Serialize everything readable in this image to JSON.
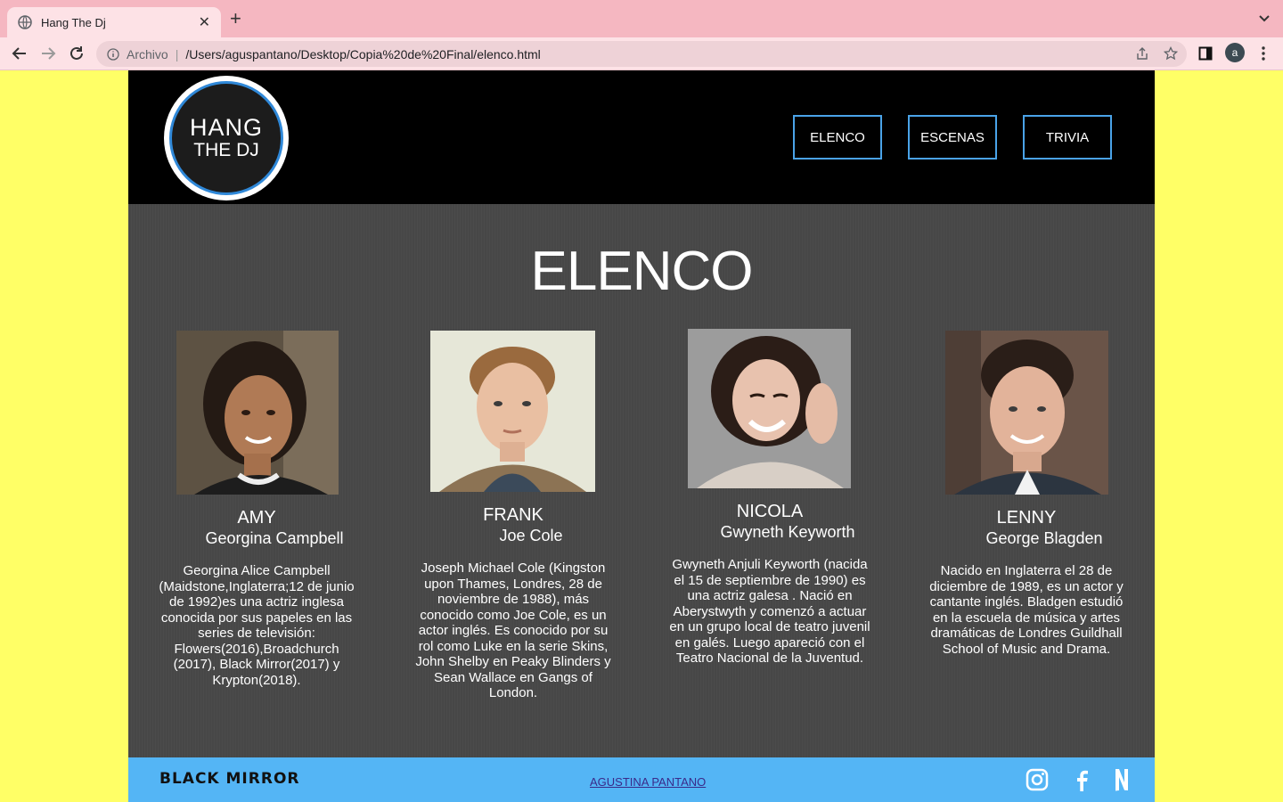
{
  "browser": {
    "tab_title": "Hang The Dj",
    "address_scheme": "Archivo",
    "address_path": "/Users/aguspantano/Desktop/Copia%20de%20Final/elenco.html",
    "profile_initial": "a"
  },
  "header": {
    "logo_line1": "HANG",
    "logo_line2": "THE DJ",
    "nav": [
      "ELENCO",
      "ESCENAS",
      "TRIVIA"
    ]
  },
  "main": {
    "title": "ELENCO",
    "cast": [
      {
        "character": "AMY",
        "actor": "Georgina Campbell",
        "bio": "Georgina Alice Campbell (Maidstone,Inglaterra;12 de junio de 1992)es una actriz inglesa conocida por sus papeles en las series de televisión: Flowers(2016),Broadchurch (2017), Black Mirror(2017) y Krypton(2018)."
      },
      {
        "character": "FRANK",
        "actor": "Joe Cole",
        "bio": "Joseph Michael Cole (Kingston upon Thames, Londres, 28 de noviembre de 1988), más conocido como Joe Cole, es un actor inglés. Es conocido por su rol como Luke en la serie Skins, John Shelby en Peaky Blinders y Sean Wallace en Gangs of London."
      },
      {
        "character": "NICOLA",
        "actor": "Gwyneth Keyworth",
        "bio": "Gwyneth Anjuli Keyworth (nacida el 15 de septiembre de 1990) es una actriz galesa . Nació en Aberystwyth y comenzó a actuar en un grupo local de teatro juvenil en galés. Luego apareció con el Teatro Nacional de la Juventud."
      },
      {
        "character": "LENNY",
        "actor": "George Blagden",
        "bio": "Nacido en Inglaterra el 28 de diciembre de 1989, es un actor y cantante inglés. Bladgen estudió en la escuela de música y artes dramáticas de Londres Guildhall School of Music and Drama."
      }
    ]
  },
  "footer": {
    "brand": "BLACK MIRROR",
    "author_link": "AGUSTINA PANTANO",
    "social_icons": [
      "instagram-icon",
      "facebook-icon",
      "netflix-icon"
    ]
  },
  "colors": {
    "page_bg": "#ffff66",
    "header_bg": "#000000",
    "main_bg": "#474747",
    "nav_border": "#4aa3e8",
    "footer_bg": "#54b5f5",
    "tab_strip": "#f5b7c1"
  }
}
